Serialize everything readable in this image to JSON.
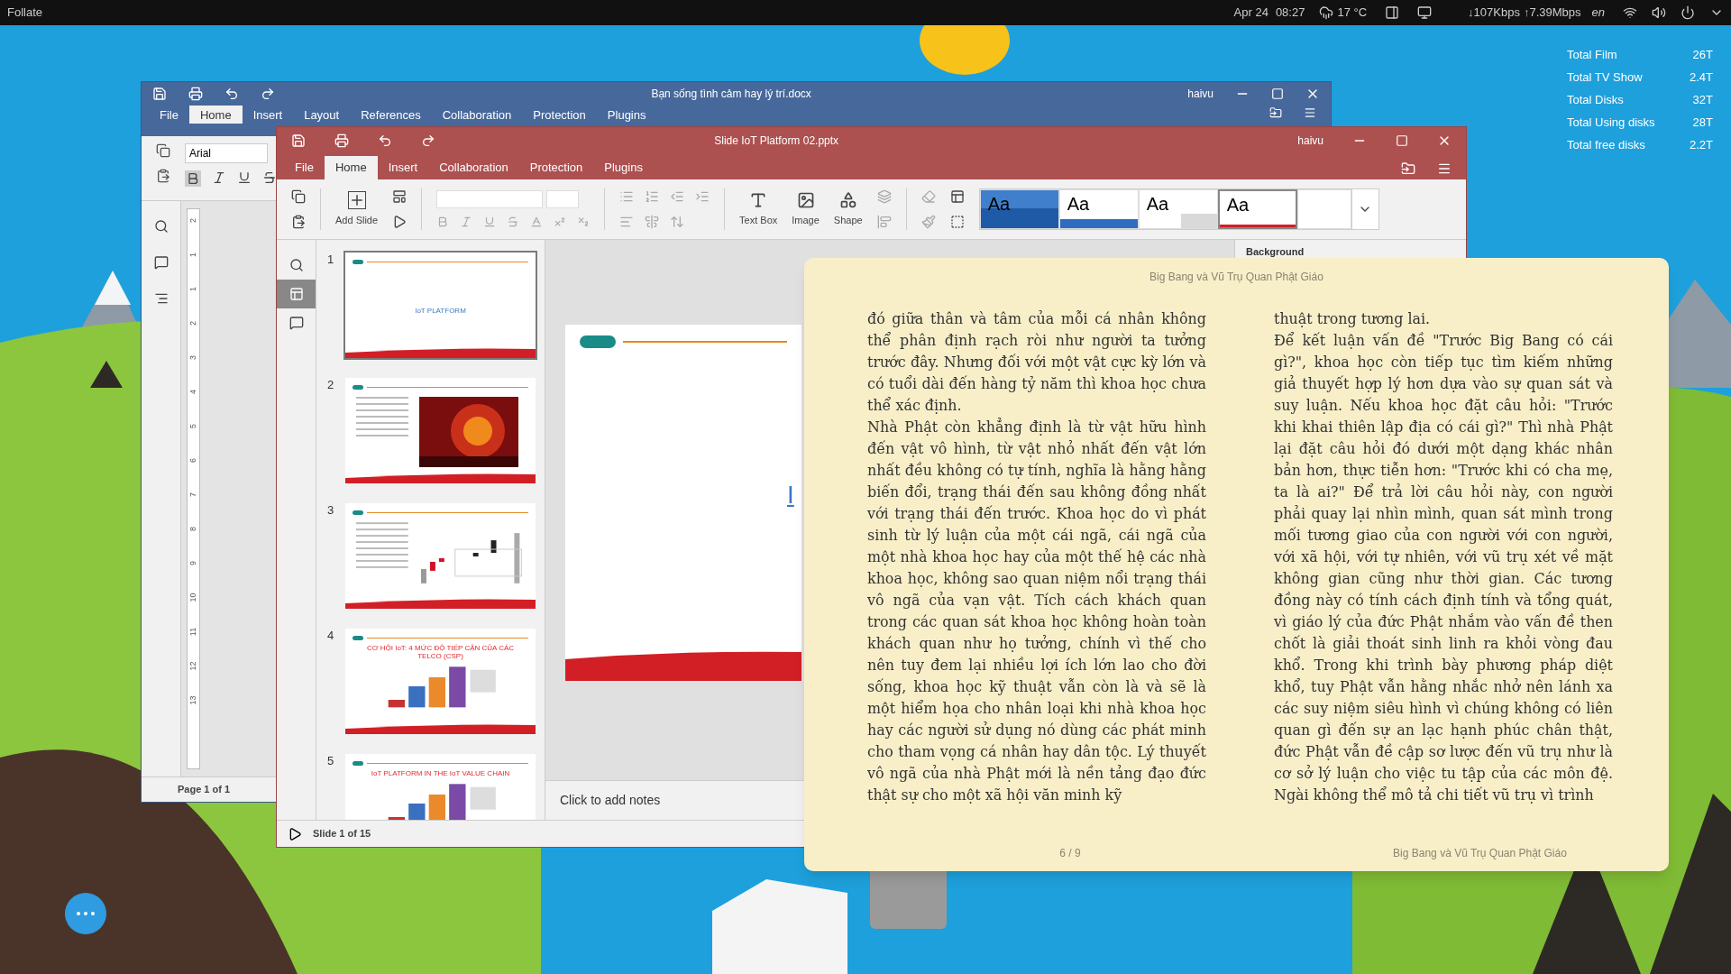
{
  "top_bar": {
    "app": "Follate",
    "date": "Apr 24",
    "time": "08:27",
    "temperature": "17 °C",
    "download": "↓107Kbps",
    "upload": "↑7.39Mbps",
    "language": "en"
  },
  "desktop_widget": {
    "rows": [
      {
        "label": "Total Film",
        "value": "26T"
      },
      {
        "label": "Total TV Show",
        "value": "2.4T"
      },
      {
        "label": "Total Disks",
        "value": "32T"
      },
      {
        "label": "Total Using disks",
        "value": "28T"
      },
      {
        "label": "Total free disks",
        "value": "2.2T"
      }
    ]
  },
  "docx_window": {
    "title": "Bạn sống tình cảm hay lý trí.docx",
    "user": "haivu",
    "tabs": [
      {
        "label": "File",
        "selected": false
      },
      {
        "label": "Home",
        "selected": true
      },
      {
        "label": "Insert",
        "selected": false
      },
      {
        "label": "Layout",
        "selected": false
      },
      {
        "label": "References",
        "selected": false
      },
      {
        "label": "Collaboration",
        "selected": false
      },
      {
        "label": "Protection",
        "selected": false
      },
      {
        "label": "Plugins",
        "selected": false
      }
    ],
    "font": "Arial",
    "ruler_marks": [
      "2",
      "1",
      "1",
      "2",
      "3",
      "4",
      "5",
      "6",
      "7",
      "8",
      "9",
      "10",
      "11",
      "12",
      "13"
    ],
    "status": "Page 1 of 1"
  },
  "pptx_window": {
    "title": "Slide IoT Platform 02.pptx",
    "user": "haivu",
    "tabs": [
      {
        "label": "File",
        "selected": false
      },
      {
        "label": "Home",
        "selected": true
      },
      {
        "label": "Insert",
        "selected": false
      },
      {
        "label": "Collaboration",
        "selected": false
      },
      {
        "label": "Protection",
        "selected": false
      },
      {
        "label": "Plugins",
        "selected": false
      }
    ],
    "toolbar": {
      "add_slide": "Add Slide",
      "text_box": "Text Box",
      "image": "Image",
      "shape": "Shape",
      "themes": [
        {
          "kind": "dots",
          "label": "Aa",
          "selected": false
        },
        {
          "kind": "wave",
          "label": "Aa",
          "selected": false
        },
        {
          "kind": "grey",
          "label": "Aa",
          "selected": false
        },
        {
          "kind": "office",
          "label": "Aa",
          "selected": true
        },
        {
          "kind": "blank",
          "selected": false
        }
      ]
    },
    "rail": [
      {
        "kind": "search",
        "selected": false
      },
      {
        "kind": "slides",
        "selected": true
      },
      {
        "kind": "comments",
        "selected": false
      }
    ],
    "slides": [
      {
        "number": "1",
        "kind": "title",
        "title": "IoT PLATFORM",
        "selected": true
      },
      {
        "number": "2",
        "kind": "text_image",
        "selected": false
      },
      {
        "number": "3",
        "kind": "text_chart",
        "selected": false
      },
      {
        "number": "4",
        "kind": "title_diagram",
        "title": "CƠ HỘI IoT: 4 MỨC ĐỘ TIẾP CẬN CỦA CÁC TELCO (CSP)",
        "selected": false
      },
      {
        "number": "5",
        "kind": "title_diagram",
        "title": "IoT PLATFORM IN THE IoT VALUE CHAIN",
        "selected": false
      }
    ],
    "canvas": {
      "title_fragment": "I"
    },
    "right_panel": {
      "title": "Background"
    },
    "notes_placeholder": "Click to add notes",
    "status": "Slide 1 of 15"
  },
  "reader": {
    "header": "Big Bang và Vũ Trụ Quan Phật Giáo",
    "columns": [
      [
        "đó giữa thân và tâm của mỗi cá nhân không thể phân định rạch ròi như người ta tưởng trước đây. Nhưng đối với một vật cực kỳ lớn và có tuổi dài đến hàng tỷ năm thì khoa học chưa thể xác định.",
        "Nhà Phật còn khẳng định là từ vật hữu hình đến vật vô hình, từ vật nhỏ nhất đến vật lớn nhất đều không có tự tính, nghĩa là hằng hằng biến đổi, trạng thái đến sau không đồng nhất với trạng thái đến trước. Khoa học do vì phát sinh từ lý luận của một cái ngã, cái ngã của một nhà khoa học hay của một thế hệ các nhà khoa học, không sao quan niệm nổi trạng thái vô ngã của vạn vật. Tích cách khách quan trong các quan sát khoa học không hoàn toàn khách quan như họ tưởng, chính vì thế cho nên tuy đem lại nhiều lợi ích lớn lao cho đời sống, khoa học kỹ thuật vẫn còn là và sẽ là một hiểm họa cho nhân loại khi nhà khoa học hay các người sử dụng nó dùng các phát minh cho tham vọng cá nhân hay dân tộc. Lý thuyết vô ngã của nhà Phật mới là nền tảng đạo đức thật sự cho một xã hội văn minh kỹ"
      ],
      [
        "thuật trong tương lai.",
        "Để kết luận vấn đề \"Trước Big Bang có cái gì?\", khoa học còn tiếp tục tìm kiếm những giả thuyết hợp lý hơn dựa vào sự quan sát và suy luận. Nếu khoa học đặt câu hỏi: \"Trước khi khai thiên lập địa có cái gì?\" Thì nhà Phật lại đặt câu hỏi đó dưới một dạng khác nhân bản hơn, thực tiễn hơn: \"Trước khi có cha mẹ, ta là ai?\" Để trả lời câu hỏi này, con người phải quay lại nhìn mình, quan sát mình trong mối tương giao của con người với con người, với xã hội, với tự nhiên, với vũ trụ xét về mặt không gian cũng như thời gian. Các tương đồng này có tính cách định tính và tổng quát, vì giáo lý của đức Phật nhắm vào vấn đề then chốt là giải thoát sinh linh ra khỏi vòng đau khổ. Trong khi trình bày phương pháp diệt khổ, tuy Phật vẫn hằng nhắc nhở nên lánh xa các suy niệm siêu hình vì chúng không có liên quan gì đến sự an lạc hạnh phúc chân thật, đức Phật vẫn đề cập sơ lược đến vũ trụ như là cơ sở lý luận cho việc tu tập của các môn đệ. Ngài không thể mô tả chi tiết vũ trụ vì trình"
      ]
    ],
    "page": "6 / 9",
    "footer_title": "Big Bang và Vũ Trụ Quan Phật Giáo"
  }
}
